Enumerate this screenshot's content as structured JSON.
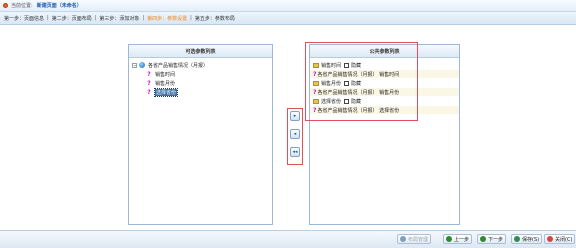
{
  "header": {
    "location_label": "当前位置:",
    "location_value": "新建页面（未命名）"
  },
  "steps": [
    {
      "label": "第一步：页面信息",
      "active": false
    },
    {
      "label": "第二步：页面布局",
      "active": false
    },
    {
      "label": "第三步：添加对象",
      "active": false
    },
    {
      "label": "第四步：参数设置",
      "active": true
    },
    {
      "label": "第五步：参数布局",
      "active": false
    }
  ],
  "left_panel": {
    "title": "可选参数列表",
    "root": {
      "expander": "−",
      "label": "各省产品销售情况（月报）"
    },
    "children": [
      "销售时间",
      "销售月份",
      "选择省份"
    ],
    "selected_index": 2
  },
  "transfer_buttons": {
    "add": "▸",
    "remove": "◂",
    "remove_all": "◂◂"
  },
  "right_panel": {
    "title": "公共参数列表",
    "items": [
      {
        "name": "销售时间",
        "hidden_label": "隐藏",
        "sub": "各省产品销售情况（月报） 销售时间"
      },
      {
        "name": "销售月份",
        "hidden_label": "隐藏",
        "sub": "各省产品销售情况（月报） 销售月份"
      },
      {
        "name": "选择省份",
        "hidden_label": "隐藏",
        "sub": "各省产品销售情况（月报） 选择省份"
      }
    ]
  },
  "footer": {
    "buttons": [
      {
        "label": "布局管理",
        "icon": "layout-icon",
        "color": "#7ea0c0",
        "disabled": true
      },
      {
        "label": "上一步",
        "icon": "back-icon",
        "color": "#2f8a2f",
        "disabled": false
      },
      {
        "label": "下一步",
        "icon": "forward-icon",
        "color": "#2f8a2f",
        "disabled": false
      },
      {
        "label": "保存(S)",
        "icon": "save-icon",
        "color": "#2e8b57",
        "disabled": false
      },
      {
        "label": "关闭(C)",
        "icon": "close-icon",
        "color": "#d64545",
        "disabled": false
      }
    ]
  }
}
